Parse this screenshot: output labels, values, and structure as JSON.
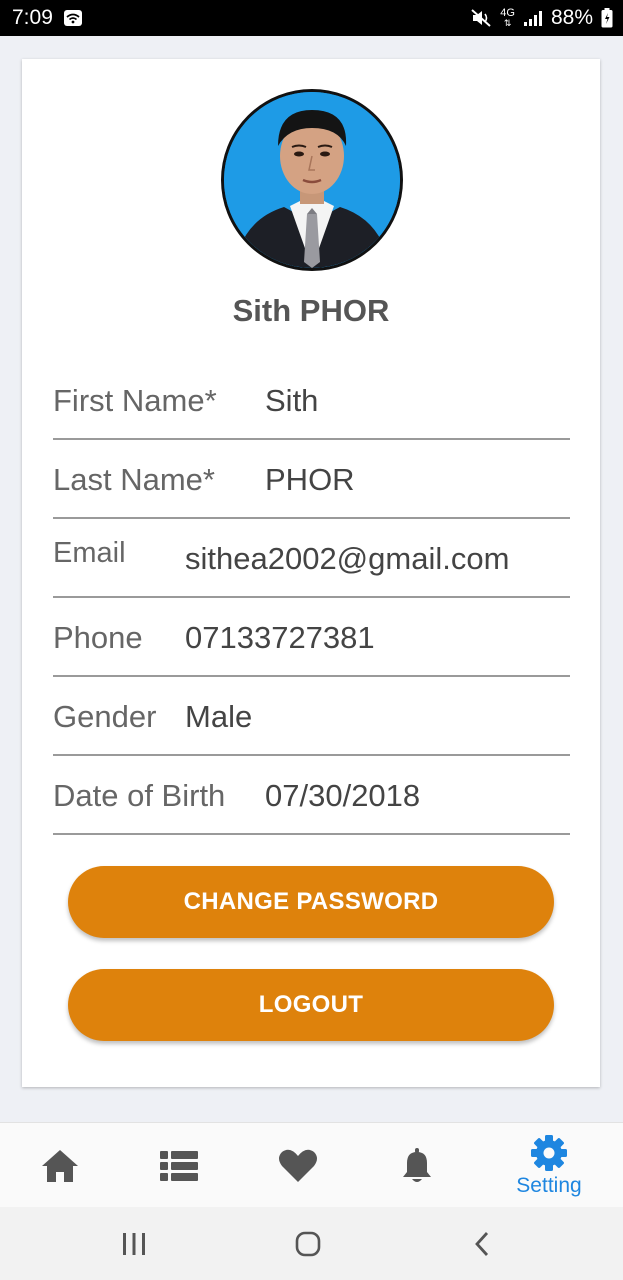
{
  "status_bar": {
    "time": "7:09",
    "battery": "88%",
    "network": "4G",
    "icons": [
      "wifi-hotspot-icon",
      "mute-icon",
      "signal-icon",
      "battery-icon"
    ]
  },
  "profile": {
    "display_name": "Sith PHOR",
    "avatar": "profile-photo"
  },
  "fields": [
    {
      "label": "First Name*",
      "value": "Sith"
    },
    {
      "label": "Last Name*",
      "value": "PHOR"
    },
    {
      "label": "Email",
      "value": "sithea2002@gmail.com"
    },
    {
      "label": "Phone",
      "value": "07133727381"
    },
    {
      "label": "Gender",
      "value": "Male"
    },
    {
      "label": "Date of Birth",
      "value": "07/30/2018"
    }
  ],
  "buttons": {
    "change_password": "CHANGE PASSWORD",
    "logout": "LOGOUT"
  },
  "bottom_nav": {
    "items": [
      {
        "icon": "home-icon",
        "label": ""
      },
      {
        "icon": "list-icon",
        "label": ""
      },
      {
        "icon": "heart-icon",
        "label": ""
      },
      {
        "icon": "bell-icon",
        "label": ""
      },
      {
        "icon": "gear-icon",
        "label": "Setting",
        "active": true
      }
    ]
  },
  "colors": {
    "accent": "#de820c",
    "active_tab": "#1e86e0",
    "inactive_icon": "#555555",
    "avatar_bg": "#1e9be6"
  }
}
